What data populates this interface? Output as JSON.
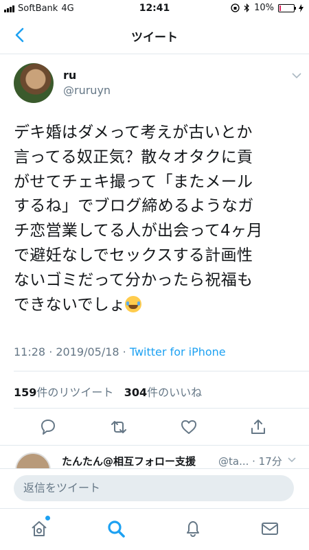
{
  "status_bar": {
    "carrier": "SoftBank",
    "network": "4G",
    "time": "12:41",
    "battery_percent": "10%",
    "battery_level": 0.1
  },
  "nav": {
    "title": "ツイート",
    "back_icon": "chevron-left-icon"
  },
  "tweet": {
    "author_name": "ru",
    "author_handle": "@ruruyn",
    "text": "デキ婚はダメって考えが古いとか\n言ってる奴正気？散々オタクに貢\nがせてチェキ撮って「またメール\nするね」でブログ締めるようなガ\nチ恋営業してる人が出会って4ヶ月\nで避妊なしでセックスする計画性\nないゴミだって分かったら祝福も\nできないでしょ",
    "emoji": "joy-emoji",
    "timestamp": "11:28 · 2019/05/18 · ",
    "client": "Twitter for iPhone",
    "retweet_count": "159",
    "retweet_label": "件のリツイート",
    "like_count": "304",
    "like_label": "件のいいね"
  },
  "reply_preview": {
    "name": "たんたん@相互フォロー支援",
    "handle": "@ta... · 17分"
  },
  "compose": {
    "placeholder": "返信をツイート"
  },
  "tabs": [
    "home-icon",
    "search-icon",
    "notifications-icon",
    "messages-icon"
  ],
  "colors": {
    "accent": "#1da1f2",
    "secondary_text": "#657786",
    "border": "#e1e8ed"
  }
}
